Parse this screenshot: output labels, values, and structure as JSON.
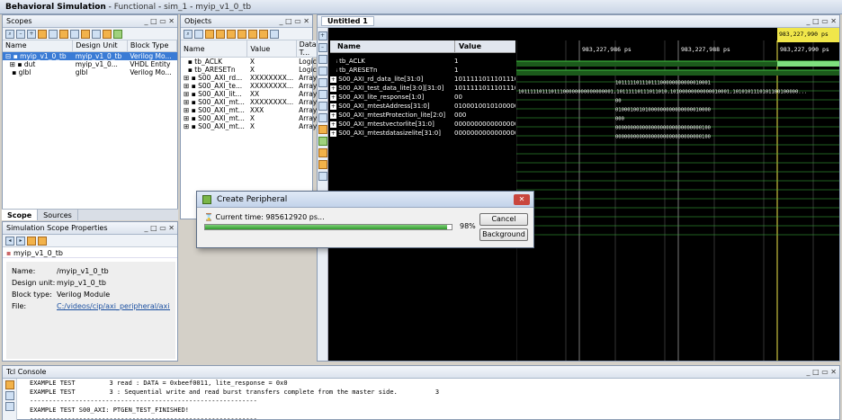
{
  "title": {
    "main": "Behavioral Simulation",
    "sep1": " - ",
    "mode": "Functional",
    "sep2": " - ",
    "sim": "sim_1",
    "sep3": " - ",
    "tb": "myip_v1_0_tb"
  },
  "scopes": {
    "title": "Scopes",
    "cols": [
      "Name",
      "Design Unit",
      "Block Type"
    ],
    "rows": [
      [
        "myip_v1_0_tb",
        "myip_v1_0_tb",
        "Verilog Mo..."
      ],
      [
        "dut",
        "myip_v1_0...",
        "VHDL Entity"
      ],
      [
        "glbl",
        "glbl",
        "Verilog Mo..."
      ]
    ],
    "tabs": [
      "Scope",
      "Sources"
    ]
  },
  "objects": {
    "title": "Objects",
    "cols": [
      "Name",
      "Value",
      "Data T..."
    ],
    "rows": [
      [
        "tb_ACLK",
        "X",
        "Logic"
      ],
      [
        "tb_ARESETn",
        "X",
        "Logic"
      ],
      [
        "S00_AXI_rd...",
        "XXXXXXXX...",
        "Array"
      ],
      [
        "S00_AXI_te...",
        "XXXXXXXX...",
        "Array"
      ],
      [
        "S00_AXI_lit...",
        "XX",
        "Array"
      ],
      [
        "S00_AXI_mt...",
        "XXXXXXXX...",
        "Array"
      ],
      [
        "S00_AXI_mt...",
        "XXX",
        "Array"
      ],
      [
        "S00_AXI_mt...",
        "X",
        "Array"
      ],
      [
        "S00_AXI_mt...",
        "X",
        "Array"
      ]
    ]
  },
  "props": {
    "title": "Simulation Scope Properties",
    "name_label": "myip_v1_0_tb",
    "rows": [
      [
        "Name:",
        "/myip_v1_0_tb"
      ],
      [
        "Design unit:",
        "myip_v1_0_tb"
      ],
      [
        "Block type:",
        "Verilog Module"
      ],
      [
        "File:",
        "C:/videos/cip/axi_peripheral/axi_peripheral"
      ]
    ]
  },
  "wave": {
    "tab": "Untitled 1",
    "name_col": "Name",
    "value_col": "Value",
    "cursor": "983,227,990 ps",
    "times": [
      "983,227,986 ps",
      "983,227,988 ps",
      "983,227,990 ps"
    ],
    "signals": [
      [
        "tb_ACLK",
        "1"
      ],
      [
        "tb_ARESETn",
        "1"
      ],
      [
        "S00_AXI_rd_data_lite[31:0]",
        "1011111011101110"
      ],
      [
        "S00_AXI_test_data_lite[3:0][31:0]",
        "1011111011101110"
      ],
      [
        "S00_AXI_lite_response[1:0]",
        "00"
      ],
      [
        "S00_AXI_mtestAddress[31:0]",
        "0100010010100000"
      ],
      [
        "S00_AXI_mtestProtection_lite[2:0]",
        "000"
      ],
      [
        "S00_AXI_mtestvectorlite[31:0]",
        "0000000000000000"
      ],
      [
        "S00_AXI_mtestdatasizelite[31:0]",
        "0000000000000000"
      ]
    ],
    "bus_values": [
      "10111110111011100000000000010001",
      "",
      "00",
      "01000100101000000000000000010000",
      "000",
      "00000000000000000000000000000100",
      "00000000000000000000000000000100"
    ],
    "test_data": "10111110111011100000000000000001,10111110111011010,10100000000000010001,1010101110101100100000..."
  },
  "dialog": {
    "title": "Create Peripheral",
    "status": "Current time: 985612920 ps...",
    "percent": "98%",
    "progress": 0.98,
    "cancel": "Cancel",
    "background": "Background"
  },
  "console": {
    "title": "Tcl Console",
    "lines": [
      "EXAMPLE TEST         3 read : DATA = 0xbeef0011, lite_response = 0x0",
      "EXAMPLE TEST         3 : Sequential write and read burst transfers complete from the master side.          3",
      "------------------------------------------------------------",
      "EXAMPLE TEST S00_AXI: PTGEN_TEST_FINISHED!",
      "------------------------------------------------------------"
    ]
  }
}
